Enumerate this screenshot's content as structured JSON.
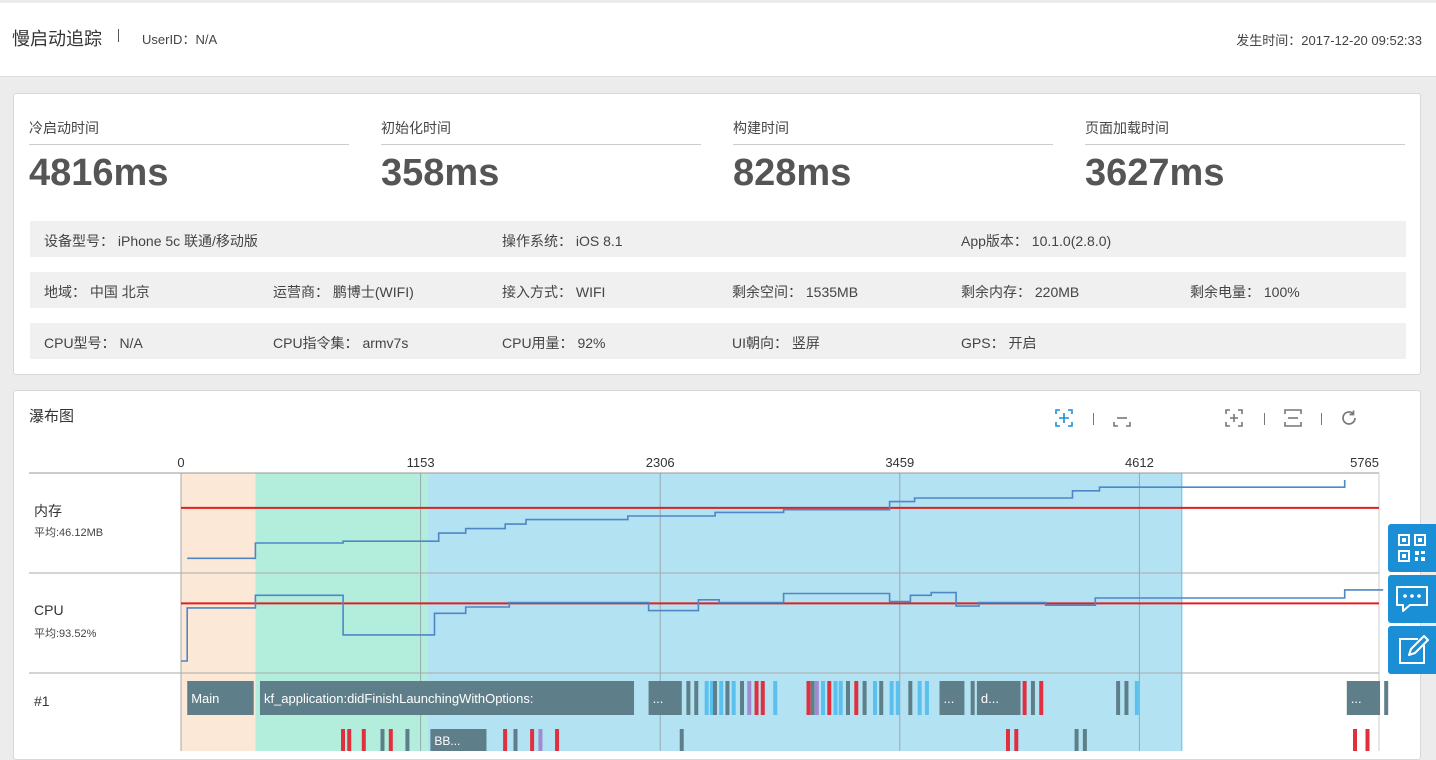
{
  "header": {
    "title": "慢启动追踪",
    "user_id": "UserID：N/A",
    "occurred_time": "发生时间：2017-12-20 09:52:33"
  },
  "metrics": [
    {
      "label": "冷启动时间",
      "value": "4816ms"
    },
    {
      "label": "初始化时间",
      "value": "358ms"
    },
    {
      "label": "构建时间",
      "value": "828ms"
    },
    {
      "label": "页面加载时间",
      "value": "3627ms"
    }
  ],
  "info_rows": [
    [
      "设备型号： iPhone 5c 联通/移动版",
      "操作系统： iOS 8.1",
      "App版本： 10.1.0(2.8.0)"
    ],
    [
      "地域： 中国 北京",
      "运营商： 鹏博士(WIFI)",
      "接入方式： WIFI",
      "剩余空间： 1535MB",
      "剩余内存： 220MB",
      "剩余电量： 100%"
    ],
    [
      "CPU型号： N/A",
      "CPU指令集： armv7s",
      "CPU用量： 92%",
      "UI朝向： 竖屏",
      "GPS： 开启"
    ]
  ],
  "waterfall": {
    "title": "瀑布图",
    "toolbar": [
      "zoom-in-icon",
      "zoom-out-icon",
      "fit-expand-icon",
      "fit-collapse-icon",
      "refresh-icon"
    ],
    "axis_ticks": [
      "0",
      "1153",
      "2306",
      "3459",
      "4612",
      "5765"
    ],
    "axis_max": 5765,
    "phases": [
      {
        "from": 0,
        "to": 358,
        "color": "#fbe8d6"
      },
      {
        "from": 358,
        "to": 1186,
        "color": "#b3eedd"
      },
      {
        "from": 1186,
        "to": 4816,
        "color": "#b3e2f2"
      }
    ],
    "memory": {
      "label": "内存",
      "avg": "平均:46.12MB",
      "threshold_level": 0.69,
      "series": [
        [
          30,
          0.13
        ],
        [
          358,
          0.13
        ],
        [
          358,
          0.3
        ],
        [
          780,
          0.3
        ],
        [
          780,
          0.32
        ],
        [
          1240,
          0.32
        ],
        [
          1240,
          0.41
        ],
        [
          1370,
          0.41
        ],
        [
          1370,
          0.46
        ],
        [
          1560,
          0.46
        ],
        [
          1560,
          0.51
        ],
        [
          1660,
          0.51
        ],
        [
          1660,
          0.56
        ],
        [
          2150,
          0.56
        ],
        [
          2150,
          0.6
        ],
        [
          2570,
          0.6
        ],
        [
          2570,
          0.64
        ],
        [
          2900,
          0.64
        ],
        [
          2900,
          0.67
        ],
        [
          3410,
          0.67
        ],
        [
          3410,
          0.76
        ],
        [
          3530,
          0.76
        ],
        [
          3530,
          0.8
        ],
        [
          4290,
          0.8
        ],
        [
          4290,
          0.88
        ],
        [
          4420,
          0.88
        ],
        [
          4420,
          0.92
        ],
        [
          5600,
          0.92
        ],
        [
          5600,
          1.0
        ]
      ]
    },
    "cpu": {
      "label": "CPU",
      "avg": "平均:93.52%",
      "threshold_level": 0.74,
      "series": [
        [
          0,
          0.1
        ],
        [
          30,
          0.1
        ],
        [
          30,
          0.69
        ],
        [
          358,
          0.69
        ],
        [
          358,
          0.83
        ],
        [
          780,
          0.83
        ],
        [
          780,
          0.39
        ],
        [
          1220,
          0.39
        ],
        [
          1220,
          0.63
        ],
        [
          1370,
          0.63
        ],
        [
          1370,
          0.7
        ],
        [
          1580,
          0.7
        ],
        [
          1580,
          0.75
        ],
        [
          2250,
          0.75
        ],
        [
          2250,
          0.66
        ],
        [
          2490,
          0.66
        ],
        [
          2490,
          0.78
        ],
        [
          2590,
          0.78
        ],
        [
          2590,
          0.75
        ],
        [
          2900,
          0.75
        ],
        [
          2900,
          0.85
        ],
        [
          3410,
          0.85
        ],
        [
          3410,
          0.76
        ],
        [
          3510,
          0.76
        ],
        [
          3510,
          0.83
        ],
        [
          3610,
          0.83
        ],
        [
          3610,
          0.86
        ],
        [
          3730,
          0.86
        ],
        [
          3730,
          0.71
        ],
        [
          3840,
          0.71
        ],
        [
          3840,
          0.75
        ],
        [
          4160,
          0.75
        ],
        [
          4160,
          0.72
        ],
        [
          4400,
          0.72
        ],
        [
          4400,
          0.8
        ],
        [
          5600,
          0.8
        ],
        [
          5600,
          0.89
        ],
        [
          5785,
          0.89
        ]
      ]
    },
    "thread": {
      "label": "#1",
      "blocks": [
        {
          "from": 30,
          "to": 350,
          "text": "Main"
        },
        {
          "from": 380,
          "to": 2180,
          "text": "kf_application:didFinishLaunchingWithOptions:"
        },
        {
          "from": 2250,
          "to": 2410,
          "text": "..."
        },
        {
          "from": 3650,
          "to": 3770,
          "text": "..."
        },
        {
          "from": 3830,
          "to": 4040,
          "text": "d..."
        },
        {
          "from": 5610,
          "to": 5770,
          "text": "..."
        }
      ],
      "sub_blocks": [
        {
          "from": 1200,
          "to": 1470,
          "text": "BB..."
        }
      ]
    }
  }
}
